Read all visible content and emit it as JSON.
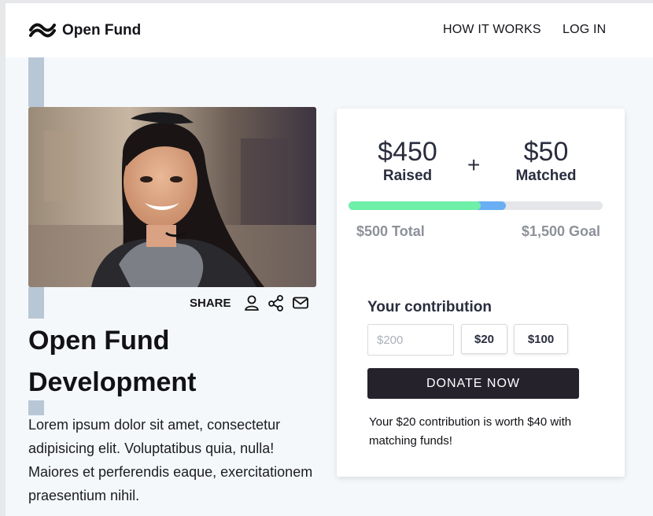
{
  "navbar": {
    "brand": "Open Fund",
    "links": [
      "HOW IT WORKS",
      "LOG IN"
    ],
    "logo_icon": "wave-logo-icon"
  },
  "project": {
    "photo": "portrait-photo",
    "share_label": "SHARE",
    "share_icons": [
      "person-icon",
      "share-icon",
      "mail-icon"
    ],
    "title": "Open Fund Development",
    "description": "Lorem ipsum dolor sit amet, consectetur adipisicing elit. Voluptatibus quia, nulla! Maiores et perferendis eaque, exercitationem praesentium nihil."
  },
  "funding": {
    "raised_amount": "$450",
    "raised_label": "Raised",
    "plus": "+",
    "matched_amount": "$50",
    "matched_label": "Matched",
    "total_label": "$500 Total",
    "goal_label": "$1,500 Goal",
    "progress_raised_fraction": 0.52,
    "progress_total_fraction": 0.62,
    "colors": {
      "raised": "#6ef0a8",
      "matched": "#6aaef4",
      "track": "#e4e6e9"
    }
  },
  "contribution": {
    "heading": "Your contribution",
    "input_placeholder": "$200",
    "input_value": "",
    "presets": [
      "$20",
      "$100"
    ],
    "donate_label": "DONATE NOW",
    "note": "Your $20 contribution is worth $40 with matching funds!"
  },
  "colors": {
    "accent_dark": "#25222c",
    "page_bg": "#f5f8fb",
    "decor_blocks": "#b8c7d6"
  }
}
